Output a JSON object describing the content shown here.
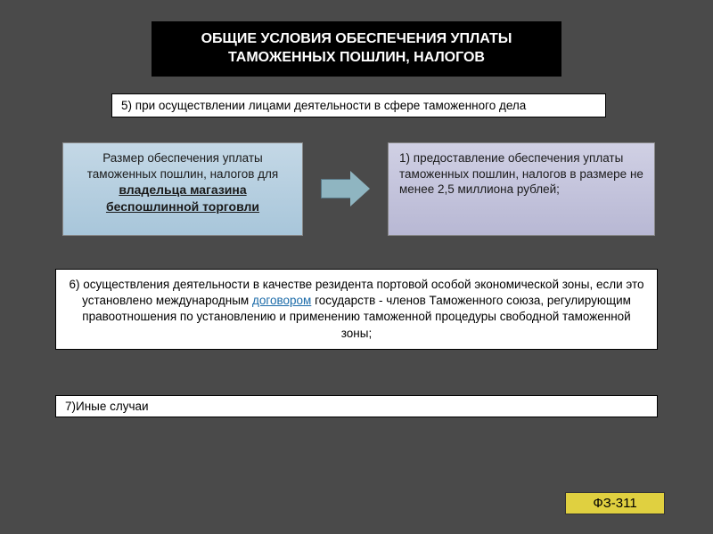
{
  "title": "ОБЩИЕ УСЛОВИЯ ОБЕСПЕЧЕНИЯ УПЛАТЫ ТАМОЖЕННЫХ ПОШЛИН, НАЛОГОВ",
  "point5": "5) при осуществлении лицами деятельности в сфере таможенного дела",
  "leftCard": {
    "line1": "Размер обеспечения уплаты таможенных пошлин, налогов для ",
    "underline": "владельца магазина беспошлинной торговли"
  },
  "rightCard": "1) предоставление обеспечения уплаты таможенных пошлин, налогов в размере не менее 2,5 миллиона рублей;",
  "point6": {
    "pre": "6) осуществления деятельности в качестве резидента портовой особой экономической зоны, если это установлено  международным ",
    "link": "договором",
    "post": " государств - членов Таможенного союза, регулирующим правоотношения по установлению и применению таможенной процедуры свободной таможенной зоны;"
  },
  "point7": "7)Иные случаи",
  "fz": "ФЗ-311"
}
